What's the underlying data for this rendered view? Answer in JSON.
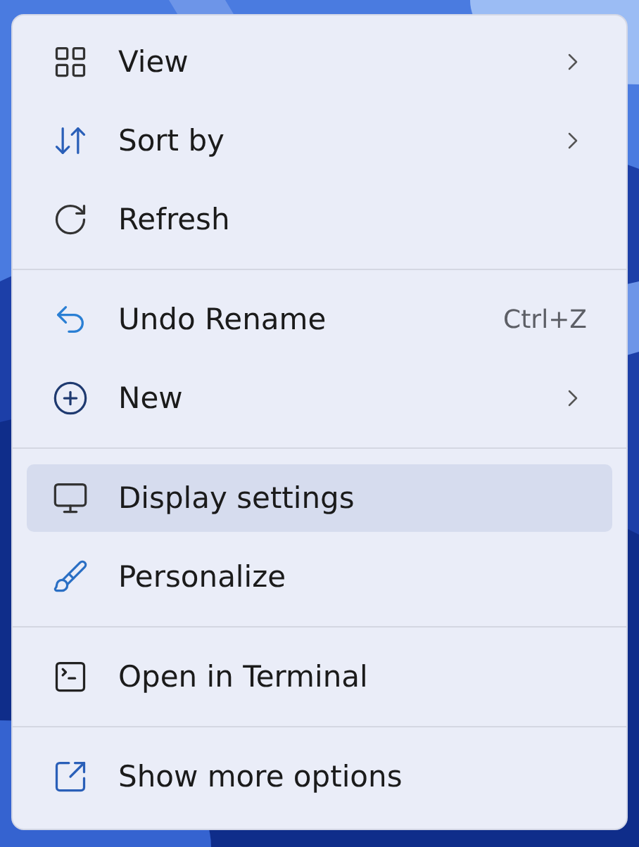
{
  "menu": {
    "groups": [
      {
        "items": [
          {
            "label": "View",
            "submenu": true,
            "selected": false
          },
          {
            "label": "Sort by",
            "submenu": true,
            "selected": false
          },
          {
            "label": "Refresh",
            "submenu": false,
            "selected": false
          }
        ]
      },
      {
        "items": [
          {
            "label": "Undo Rename",
            "shortcut": "Ctrl+Z",
            "submenu": false,
            "selected": false
          },
          {
            "label": "New",
            "submenu": true,
            "selected": false
          }
        ]
      },
      {
        "items": [
          {
            "label": "Display settings",
            "submenu": false,
            "selected": true
          },
          {
            "label": "Personalize",
            "submenu": false,
            "selected": false
          }
        ]
      },
      {
        "items": [
          {
            "label": "Open in Terminal",
            "submenu": false,
            "selected": false
          }
        ]
      },
      {
        "items": [
          {
            "label": "Show more options",
            "submenu": false,
            "selected": false
          }
        ]
      }
    ]
  }
}
